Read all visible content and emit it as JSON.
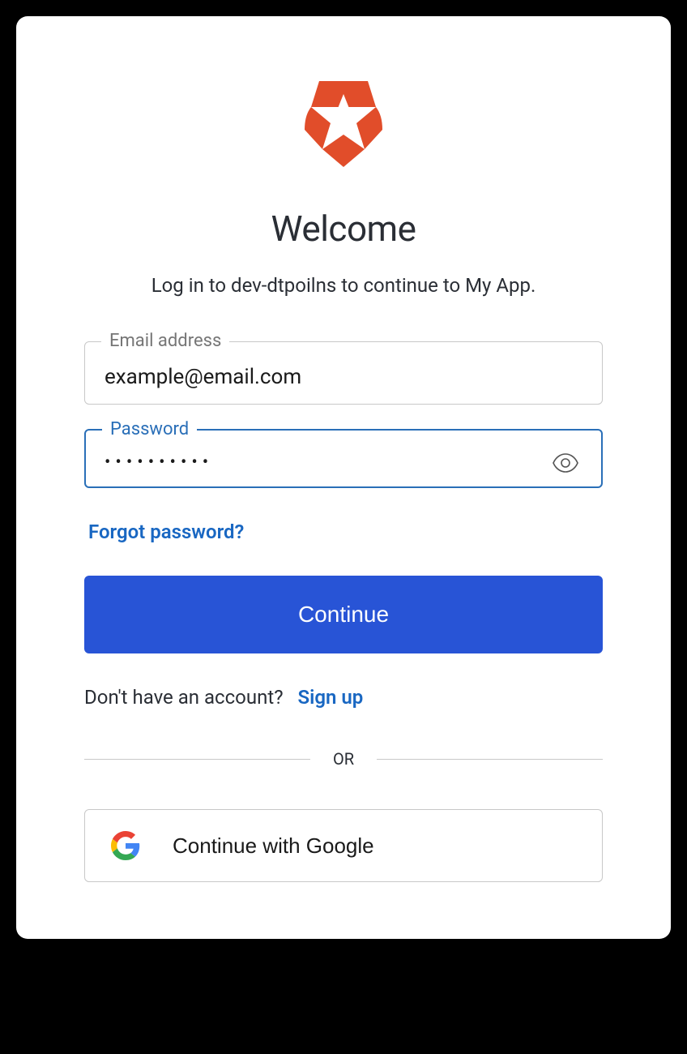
{
  "title": "Welcome",
  "subtitle": "Log in to dev-dtpoilns to continue to My App.",
  "fields": {
    "email": {
      "label": "Email address",
      "value": "example@email.com"
    },
    "password": {
      "label": "Password",
      "value": "••••••••••"
    }
  },
  "forgot_label": "Forgot password?",
  "continue_label": "Continue",
  "signup_prompt": "Don't have an account?",
  "signup_label": "Sign up",
  "divider_label": "OR",
  "social": {
    "google_label": "Continue with Google"
  },
  "colors": {
    "brand_orange": "#e64a19",
    "primary_blue": "#2854d6",
    "link_blue": "#1967c2",
    "focus_blue": "#2a6fb8"
  }
}
